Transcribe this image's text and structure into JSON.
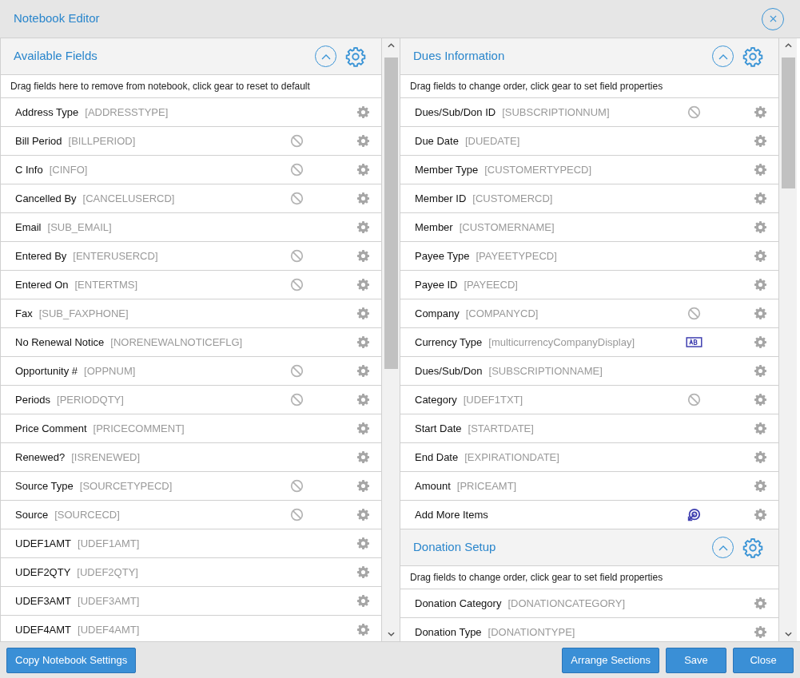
{
  "window": {
    "title": "Notebook Editor"
  },
  "available_fields": {
    "title": "Available Fields",
    "hint": "Drag fields here to remove from notebook, click gear to reset to default",
    "fields": [
      {
        "kind": "plain",
        "name": "Address Type",
        "code": "[ADDRESSTYPE]"
      },
      {
        "kind": "hidden",
        "name": "Bill Period",
        "code": "[BILLPERIOD]"
      },
      {
        "kind": "hidden",
        "name": "C Info",
        "code": "[CINFO]"
      },
      {
        "kind": "hidden",
        "name": "Cancelled By",
        "code": "[CANCELUSERCD]"
      },
      {
        "kind": "plain",
        "name": "Email",
        "code": "[SUB_EMAIL]"
      },
      {
        "kind": "hidden",
        "name": "Entered By",
        "code": "[ENTERUSERCD]"
      },
      {
        "kind": "hidden",
        "name": "Entered On",
        "code": "[ENTERTMS]"
      },
      {
        "kind": "plain",
        "name": "Fax",
        "code": "[SUB_FAXPHONE]"
      },
      {
        "kind": "plain",
        "name": "No Renewal Notice",
        "code": "[NORENEWALNOTICEFLG]"
      },
      {
        "kind": "hidden",
        "name": "Opportunity #",
        "code": "[OPPNUM]"
      },
      {
        "kind": "hidden",
        "name": "Periods",
        "code": "[PERIODQTY]"
      },
      {
        "kind": "plain",
        "name": "Price Comment",
        "code": "[PRICECOMMENT]"
      },
      {
        "kind": "plain",
        "name": "Renewed?",
        "code": "[ISRENEWED]"
      },
      {
        "kind": "hidden",
        "name": "Source Type",
        "code": "[SOURCETYPECD]"
      },
      {
        "kind": "hidden",
        "name": "Source",
        "code": "[SOURCECD]"
      },
      {
        "kind": "plain",
        "name": "UDEF1AMT",
        "code": "[UDEF1AMT]"
      },
      {
        "kind": "plain",
        "name": "UDEF2QTY",
        "code": "[UDEF2QTY]"
      },
      {
        "kind": "plain",
        "name": "UDEF3AMT",
        "code": "[UDEF3AMT]"
      },
      {
        "kind": "plain",
        "name": "UDEF4AMT",
        "code": "[UDEF4AMT]"
      }
    ]
  },
  "sections": [
    {
      "title": "Dues Information",
      "hint": "Drag fields to change order, click gear to set field properties",
      "fields": [
        {
          "kind": "hidden",
          "name": "Dues/Sub/Don ID",
          "code": "[SUBSCRIPTIONNUM]"
        },
        {
          "kind": "plain",
          "name": "Due Date",
          "code": "[DUEDATE]"
        },
        {
          "kind": "plain",
          "name": "Member Type",
          "code": "[CUSTOMERTYPECD]"
        },
        {
          "kind": "plain",
          "name": "Member ID",
          "code": "[CUSTOMERCD]"
        },
        {
          "kind": "plain",
          "name": "Member",
          "code": "[CUSTOMERNAME]"
        },
        {
          "kind": "plain",
          "name": "Payee Type",
          "code": "[PAYEETYPECD]"
        },
        {
          "kind": "plain",
          "name": "Payee ID",
          "code": "[PAYEECD]"
        },
        {
          "kind": "hidden",
          "name": "Company",
          "code": "[COMPANYCD]"
        },
        {
          "kind": "textbox",
          "name": "Currency Type",
          "code": "[multicurrencyCompanyDisplay]"
        },
        {
          "kind": "plain",
          "name": "Dues/Sub/Don",
          "code": "[SUBSCRIPTIONNAME]"
        },
        {
          "kind": "hidden",
          "name": "Category",
          "code": "[UDEF1TXT]"
        },
        {
          "kind": "plain",
          "name": "Start Date",
          "code": "[STARTDATE]"
        },
        {
          "kind": "plain",
          "name": "End Date",
          "code": "[EXPIRATIONDATE]"
        },
        {
          "kind": "plain",
          "name": "Amount",
          "code": "[PRICEAMT]"
        },
        {
          "kind": "more",
          "name": "Add More Items"
        }
      ]
    },
    {
      "title": "Donation Setup",
      "hint": "Drag fields to change order, click gear to set field properties",
      "fields": [
        {
          "kind": "plain",
          "name": "Donation Category",
          "code": "[DONATIONCATEGORY]"
        },
        {
          "kind": "plain",
          "name": "Donation Type",
          "code": "[DONATIONTYPE]"
        }
      ]
    }
  ],
  "buttons": {
    "left": [
      "Copy Notebook Settings"
    ],
    "right": [
      "Arrange Sections",
      "Save",
      "Close"
    ]
  }
}
